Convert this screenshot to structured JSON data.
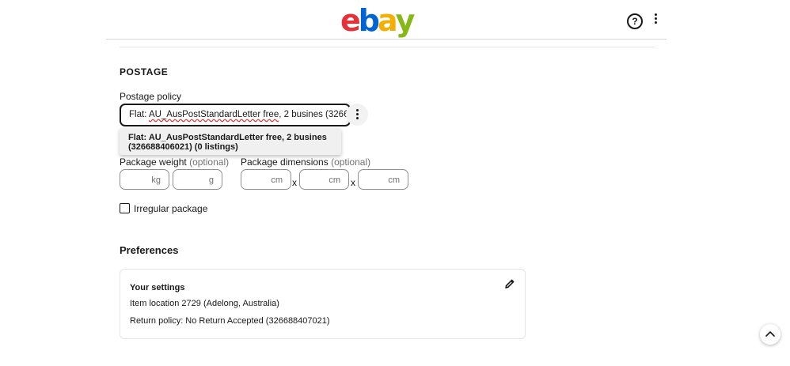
{
  "header": {
    "logo_letters": [
      {
        "char": "e",
        "color": "#e53238"
      },
      {
        "char": "b",
        "color": "#0064d2"
      },
      {
        "char": "a",
        "color": "#f5af02"
      },
      {
        "char": "y",
        "color": "#86b817"
      }
    ],
    "help_label": "?",
    "help_icon": "help-circle-icon",
    "menu_icon": "kebab-menu-icon"
  },
  "postage": {
    "section_title": "POSTAGE",
    "policy_label": "Postage policy",
    "policy_value_prefix": "Flat: ",
    "policy_value_flagged": "AU_AusPostStandardLetter free",
    "policy_value_suffix": ", 2 busines (32668",
    "dropdown_option": "Flat: AU_AusPostStandardLetter free, 2 busines (326688406021) (0 listings)",
    "weight_label": "Package weight",
    "dimensions_label": "Package dimensions",
    "optional_text": "(optional)",
    "weight_units": [
      "kg",
      "g"
    ],
    "dimension_units": [
      "cm",
      "cm",
      "cm"
    ],
    "dimension_separator": "x",
    "irregular_label": "Irregular package",
    "irregular_checked": false
  },
  "preferences": {
    "title": "Preferences",
    "card_title": "Your settings",
    "item_location": "Item location 2729 (Adelong, Australia)",
    "return_policy": "Return policy: No Return Accepted (326688407021)",
    "edit_icon": "pencil-icon"
  },
  "scroll_top_icon": "chevron-up-icon"
}
